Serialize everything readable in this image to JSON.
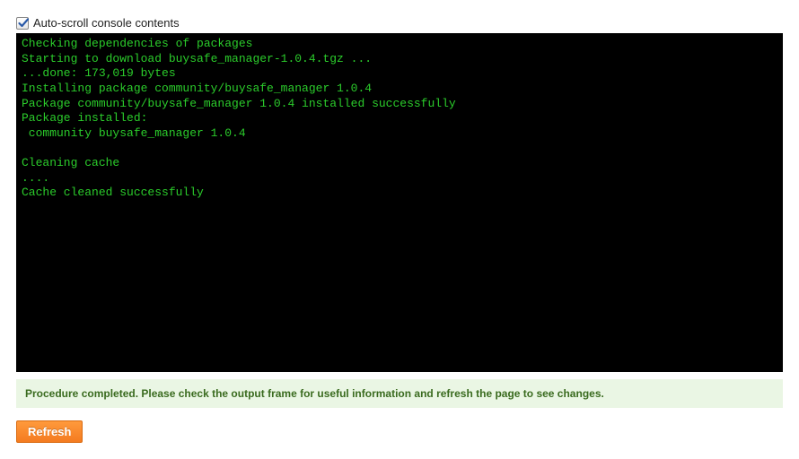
{
  "toolbar": {
    "auto_scroll_label": "Auto-scroll console contents",
    "auto_scroll_checked": true
  },
  "console": {
    "lines": [
      "Checking dependencies of packages",
      "Starting to download buysafe_manager-1.0.4.tgz ...",
      "...done: 173,019 bytes",
      "Installing package community/buysafe_manager 1.0.4",
      "Package community/buysafe_manager 1.0.4 installed successfully",
      "Package installed:",
      " community buysafe_manager 1.0.4",
      "",
      "Cleaning cache",
      "....",
      "Cache cleaned successfully"
    ]
  },
  "status": {
    "message": "Procedure completed. Please check the output frame for useful information and refresh the page to see changes."
  },
  "actions": {
    "refresh_label": "Refresh"
  }
}
